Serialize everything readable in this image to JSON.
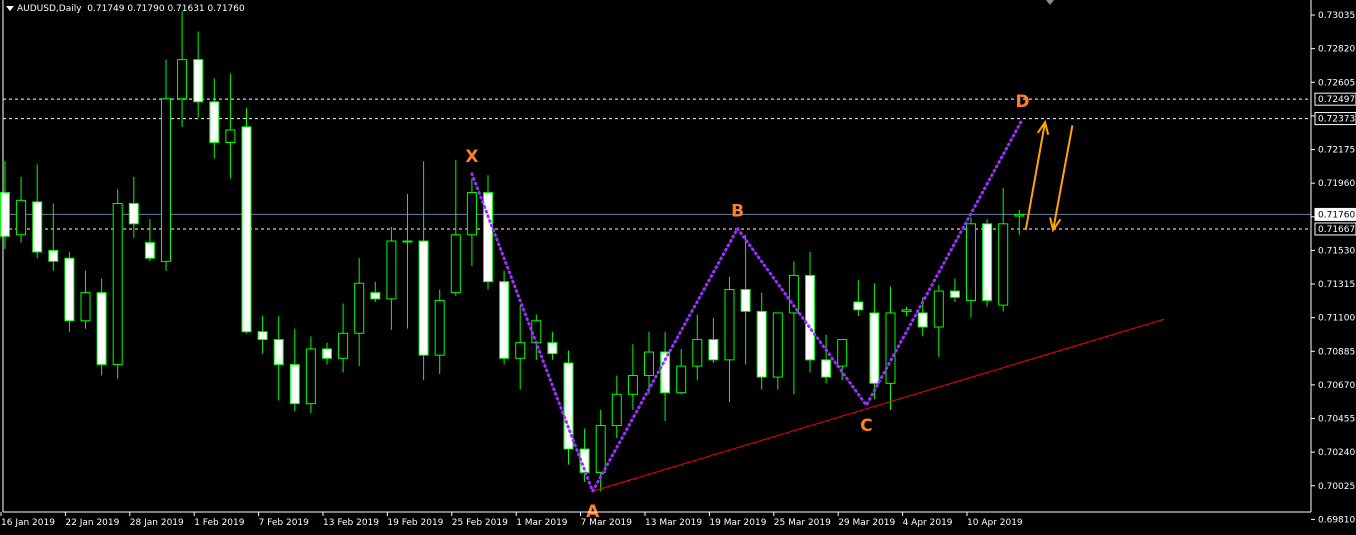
{
  "header": {
    "symbol": "AUDUSD,Daily",
    "ohlc": "0.71749 0.71790 0.71631 0.71760"
  },
  "colors": {
    "background": "#000000",
    "bull": "#00ff00",
    "bear_fill": "#ffffff",
    "pattern_line": "#9b30ff",
    "pattern_label": "#ff7f27",
    "trendline": "#ff0000",
    "arrows": "#ffa500",
    "hline": "#ffffff",
    "current_price_line": "#6b7fa8"
  },
  "chart_data": {
    "type": "candlestick",
    "instrument": "AUDUSD",
    "timeframe": "Daily",
    "ylim": [
      0.6987,
      0.7308
    ],
    "y_ticks": [
      "0.73035",
      "0.72820",
      "0.72605",
      "0.72390",
      "0.72175",
      "0.71960",
      "0.71745",
      "0.71530",
      "0.71315",
      "0.71100",
      "0.70885",
      "0.70670",
      "0.70455",
      "0.70240",
      "0.70025",
      "0.69810"
    ],
    "x_ticks": [
      {
        "index": 0,
        "label": "16 Jan 2019"
      },
      {
        "index": 4,
        "label": "22 Jan 2019"
      },
      {
        "index": 8,
        "label": "28 Jan 2019"
      },
      {
        "index": 12,
        "label": "1 Feb 2019"
      },
      {
        "index": 16,
        "label": "7 Feb 2019"
      },
      {
        "index": 20,
        "label": "13 Feb 2019"
      },
      {
        "index": 24,
        "label": "19 Feb 2019"
      },
      {
        "index": 28,
        "label": "25 Feb 2019"
      },
      {
        "index": 32,
        "label": "1 Mar 2019"
      },
      {
        "index": 36,
        "label": "7 Mar 2019"
      },
      {
        "index": 40,
        "label": "13 Mar 2019"
      },
      {
        "index": 44,
        "label": "19 Mar 2019"
      },
      {
        "index": 48,
        "label": "25 Mar 2019"
      },
      {
        "index": 52,
        "label": "29 Mar 2019"
      },
      {
        "index": 56,
        "label": "4 Apr 2019"
      },
      {
        "index": 60,
        "label": "10 Apr 2019"
      }
    ],
    "candles": [
      {
        "o": 0.719,
        "h": 0.721,
        "l": 0.7154,
        "c": 0.7162
      },
      {
        "o": 0.7163,
        "h": 0.72,
        "l": 0.7158,
        "c": 0.7185
      },
      {
        "o": 0.7184,
        "h": 0.7208,
        "l": 0.7148,
        "c": 0.7152
      },
      {
        "o": 0.7153,
        "h": 0.7183,
        "l": 0.714,
        "c": 0.7146
      },
      {
        "o": 0.7148,
        "h": 0.7152,
        "l": 0.7101,
        "c": 0.7108
      },
      {
        "o": 0.7108,
        "h": 0.714,
        "l": 0.7103,
        "c": 0.7126
      },
      {
        "o": 0.7126,
        "h": 0.7135,
        "l": 0.7073,
        "c": 0.708
      },
      {
        "o": 0.708,
        "h": 0.7192,
        "l": 0.7071,
        "c": 0.7183
      },
      {
        "o": 0.7183,
        "h": 0.72,
        "l": 0.7161,
        "c": 0.717
      },
      {
        "o": 0.7158,
        "h": 0.7173,
        "l": 0.7146,
        "c": 0.7148
      },
      {
        "o": 0.7146,
        "h": 0.7275,
        "l": 0.714,
        "c": 0.725
      },
      {
        "o": 0.725,
        "h": 0.7306,
        "l": 0.7232,
        "c": 0.7275
      },
      {
        "o": 0.7275,
        "h": 0.7293,
        "l": 0.7238,
        "c": 0.7248
      },
      {
        "o": 0.7248,
        "h": 0.7263,
        "l": 0.7212,
        "c": 0.7222
      },
      {
        "o": 0.7222,
        "h": 0.7266,
        "l": 0.7199,
        "c": 0.723
      },
      {
        "o": 0.7232,
        "h": 0.7244,
        "l": 0.71,
        "c": 0.7101
      },
      {
        "o": 0.7101,
        "h": 0.7111,
        "l": 0.7087,
        "c": 0.7096
      },
      {
        "o": 0.7096,
        "h": 0.7111,
        "l": 0.7057,
        "c": 0.708
      },
      {
        "o": 0.708,
        "h": 0.7103,
        "l": 0.705,
        "c": 0.7055
      },
      {
        "o": 0.7055,
        "h": 0.7098,
        "l": 0.7049,
        "c": 0.709
      },
      {
        "o": 0.709,
        "h": 0.7094,
        "l": 0.708,
        "c": 0.7084
      },
      {
        "o": 0.7084,
        "h": 0.7119,
        "l": 0.7075,
        "c": 0.71
      },
      {
        "o": 0.71,
        "h": 0.7148,
        "l": 0.7079,
        "c": 0.7132
      },
      {
        "o": 0.7126,
        "h": 0.7133,
        "l": 0.712,
        "c": 0.7122
      },
      {
        "o": 0.7122,
        "h": 0.7168,
        "l": 0.7102,
        "c": 0.7159
      },
      {
        "o": 0.7159,
        "h": 0.7189,
        "l": 0.7103,
        "c": 0.7159
      },
      {
        "o": 0.7159,
        "h": 0.721,
        "l": 0.707,
        "c": 0.7086
      },
      {
        "o": 0.7086,
        "h": 0.7128,
        "l": 0.7074,
        "c": 0.7121
      },
      {
        "o": 0.7126,
        "h": 0.7211,
        "l": 0.7124,
        "c": 0.7163
      },
      {
        "o": 0.7163,
        "h": 0.7199,
        "l": 0.7143,
        "c": 0.719
      },
      {
        "o": 0.719,
        "h": 0.7201,
        "l": 0.7128,
        "c": 0.7133
      },
      {
        "o": 0.7133,
        "h": 0.714,
        "l": 0.708,
        "c": 0.7084
      },
      {
        "o": 0.7084,
        "h": 0.7118,
        "l": 0.7064,
        "c": 0.7094
      },
      {
        "o": 0.7094,
        "h": 0.7112,
        "l": 0.7083,
        "c": 0.7108
      },
      {
        "o": 0.7094,
        "h": 0.7101,
        "l": 0.7083,
        "c": 0.7087
      },
      {
        "o": 0.7081,
        "h": 0.7089,
        "l": 0.7016,
        "c": 0.7026
      },
      {
        "o": 0.7026,
        "h": 0.7039,
        "l": 0.7005,
        "c": 0.7011
      },
      {
        "o": 0.7011,
        "h": 0.7051,
        "l": 0.6999,
        "c": 0.7041
      },
      {
        "o": 0.7041,
        "h": 0.7073,
        "l": 0.7033,
        "c": 0.7061
      },
      {
        "o": 0.7061,
        "h": 0.7093,
        "l": 0.7051,
        "c": 0.7073
      },
      {
        "o": 0.7073,
        "h": 0.7101,
        "l": 0.7061,
        "c": 0.7088
      },
      {
        "o": 0.7088,
        "h": 0.7101,
        "l": 0.7044,
        "c": 0.7062
      },
      {
        "o": 0.7062,
        "h": 0.709,
        "l": 0.7061,
        "c": 0.7079
      },
      {
        "o": 0.7079,
        "h": 0.7112,
        "l": 0.707,
        "c": 0.7096
      },
      {
        "o": 0.7096,
        "h": 0.711,
        "l": 0.7081,
        "c": 0.7083
      },
      {
        "o": 0.7083,
        "h": 0.7136,
        "l": 0.7056,
        "c": 0.7128
      },
      {
        "o": 0.7128,
        "h": 0.7163,
        "l": 0.708,
        "c": 0.7114
      },
      {
        "o": 0.7114,
        "h": 0.7126,
        "l": 0.7064,
        "c": 0.7072
      },
      {
        "o": 0.7072,
        "h": 0.7113,
        "l": 0.7064,
        "c": 0.7113
      },
      {
        "o": 0.7113,
        "h": 0.7146,
        "l": 0.7061,
        "c": 0.7137
      },
      {
        "o": 0.7137,
        "h": 0.7152,
        "l": 0.7075,
        "c": 0.7083
      },
      {
        "o": 0.7083,
        "h": 0.7099,
        "l": 0.7068,
        "c": 0.7072
      },
      {
        "o": 0.7079,
        "h": 0.7096,
        "l": 0.707,
        "c": 0.7096
      },
      {
        "o": 0.712,
        "h": 0.7134,
        "l": 0.7111,
        "c": 0.7115
      },
      {
        "o": 0.7113,
        "h": 0.7132,
        "l": 0.7058,
        "c": 0.7068
      },
      {
        "o": 0.7068,
        "h": 0.713,
        "l": 0.7051,
        "c": 0.7113
      },
      {
        "o": 0.7114,
        "h": 0.7117,
        "l": 0.7111,
        "c": 0.7115
      },
      {
        "o": 0.7113,
        "h": 0.7123,
        "l": 0.7098,
        "c": 0.7104
      },
      {
        "o": 0.7104,
        "h": 0.7131,
        "l": 0.7085,
        "c": 0.7127
      },
      {
        "o": 0.7127,
        "h": 0.7135,
        "l": 0.712,
        "c": 0.7123
      },
      {
        "o": 0.7121,
        "h": 0.7174,
        "l": 0.711,
        "c": 0.717
      },
      {
        "o": 0.717,
        "h": 0.7173,
        "l": 0.7117,
        "c": 0.7121
      },
      {
        "o": 0.7118,
        "h": 0.7193,
        "l": 0.7114,
        "c": 0.717
      },
      {
        "o": 0.7175,
        "h": 0.7179,
        "l": 0.7163,
        "c": 0.7176
      }
    ],
    "price_lines": [
      {
        "price": 0.72497,
        "label": "0.72497",
        "style": "dashed"
      },
      {
        "price": 0.72373,
        "label": "0.72373",
        "style": "dashed"
      },
      {
        "price": 0.71667,
        "label": "0.71667",
        "style": "dashed"
      },
      {
        "price": 0.7176,
        "label": "0.71760",
        "style": "solid",
        "current": true
      }
    ],
    "pattern_points": [
      {
        "name": "X",
        "index": 29,
        "price": 0.7202,
        "label_pos": "above"
      },
      {
        "name": "A",
        "index": 36.5,
        "price": 0.6999,
        "label_pos": "below"
      },
      {
        "name": "B",
        "index": 45.5,
        "price": 0.7167,
        "label_pos": "above"
      },
      {
        "name": "C",
        "index": 53.5,
        "price": 0.7054,
        "label_pos": "below"
      },
      {
        "name": "D",
        "index": 63.2,
        "price": 0.7237,
        "label_pos": "above"
      }
    ],
    "trendline": {
      "from": {
        "index": 36.5,
        "price": 0.6999
      },
      "to": {
        "index": 72,
        "price": 0.7109
      }
    },
    "arrows": [
      {
        "direction": "up",
        "from": {
          "index": 63.4,
          "price": 0.7166
        },
        "to": {
          "index": 64.6,
          "price": 0.7235
        }
      },
      {
        "direction": "down",
        "from": {
          "index": 66.3,
          "price": 0.7233
        },
        "to": {
          "index": 65.1,
          "price": 0.7166
        }
      }
    ]
  }
}
